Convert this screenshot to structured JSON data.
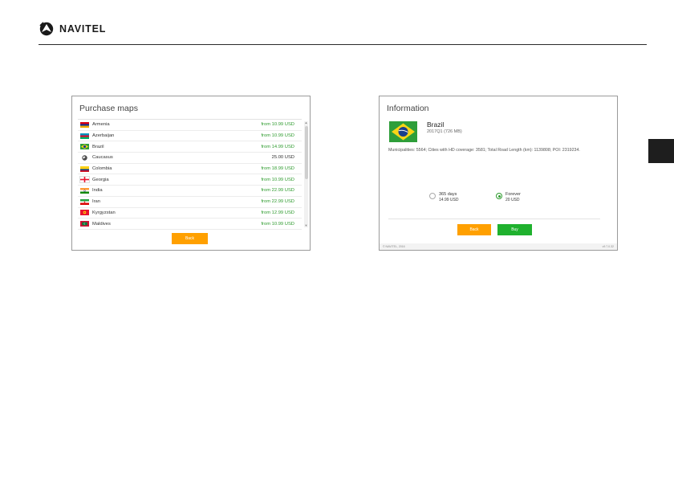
{
  "brand": {
    "name": "NAVITEL"
  },
  "purchase_screen": {
    "title": "Purchase maps",
    "countries": [
      {
        "name": "Armenia",
        "price": "from 10.99 USD",
        "flag": "armenia"
      },
      {
        "name": "Azerbaijan",
        "price": "from 10.99 USD",
        "flag": "azerbaijan"
      },
      {
        "name": "Brazil",
        "price": "from 14.99 USD",
        "flag": "brazil"
      },
      {
        "name": "Caucasus",
        "price": "25.00 USD",
        "flag": "globe"
      },
      {
        "name": "Colombia",
        "price": "from 18.99 USD",
        "flag": "colombia"
      },
      {
        "name": "Georgia",
        "price": "from 10.99 USD",
        "flag": "georgia"
      },
      {
        "name": "India",
        "price": "from 22.99 USD",
        "flag": "india"
      },
      {
        "name": "Iran",
        "price": "from 22.99 USD",
        "flag": "iran"
      },
      {
        "name": "Kyrgyzstan",
        "price": "from 12.99 USD",
        "flag": "kyrgyzstan"
      },
      {
        "name": "Maldives",
        "price": "from 10.99 USD",
        "flag": "maldives"
      }
    ],
    "back_label": "Back"
  },
  "info_screen": {
    "title": "Information",
    "country": "Brazil",
    "version": "2017Q1 (726 MB)",
    "stats": "Municipalities: 5564; Cities with HD coverage: 3581; Total Road Length (km): 1139808; POI: 2319234.",
    "options": [
      {
        "label": "365 days",
        "price": "14.99 USD",
        "selected": false
      },
      {
        "label": "Forever",
        "price": "20 USD",
        "selected": true
      }
    ],
    "back_label": "Back",
    "buy_label": "Buy",
    "footer_left": "© NAVITEL, 2016",
    "footer_right": "v9.7.0.32"
  },
  "colors": {
    "price_green": "#2e9b2e",
    "button_orange": "#ffa000",
    "button_green": "#1fb12e",
    "side_tab": "#1e1e1e"
  }
}
